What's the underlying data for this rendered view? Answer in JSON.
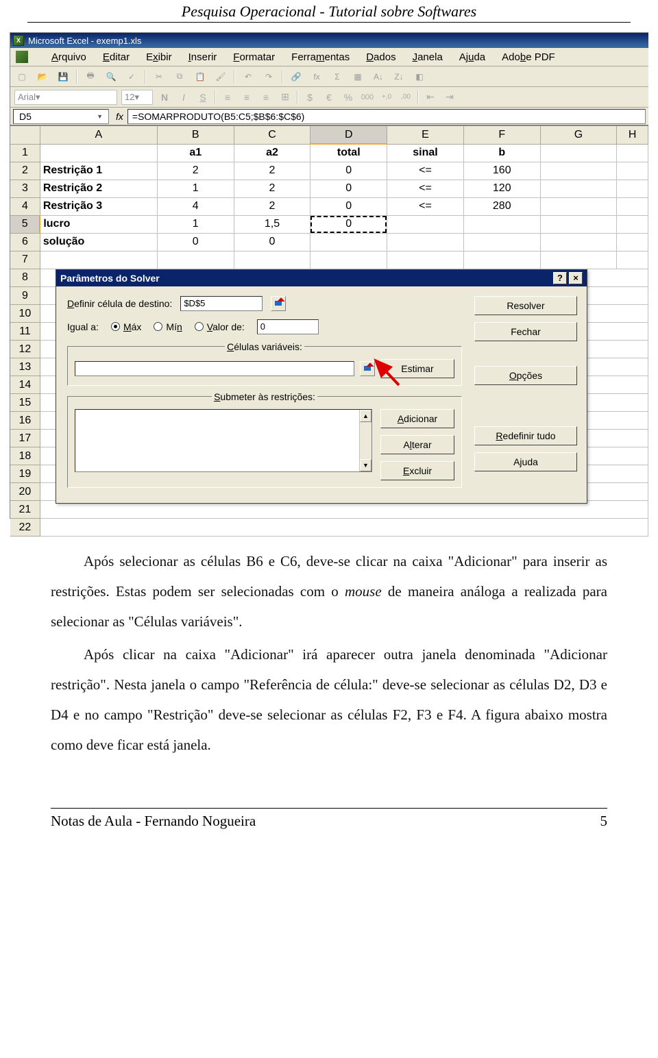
{
  "header_title": "Pesquisa Operacional - Tutorial sobre Softwares",
  "excel": {
    "title": "Microsoft Excel - exemp1.xls",
    "menus": [
      "Arquivo",
      "Editar",
      "Exibir",
      "Inserir",
      "Formatar",
      "Ferramentas",
      "Dados",
      "Janela",
      "Ajuda",
      "Adobe PDF"
    ],
    "font_name": "Arial",
    "font_size": "12",
    "cell_ref": "D5",
    "fx_label": "fx",
    "formula": "=SOMARPRODUTO(B5:C5;$B$6:$C$6)",
    "col_headers": [
      "A",
      "B",
      "C",
      "D",
      "E",
      "F",
      "G",
      "H"
    ],
    "row_numbers": [
      1,
      2,
      3,
      4,
      5,
      6,
      7,
      8,
      9,
      10,
      11,
      12,
      13,
      14,
      15,
      16,
      17,
      18,
      19,
      20,
      21,
      22
    ],
    "selected_col": "D",
    "selected_row": 5,
    "rows": {
      "1": {
        "A": "",
        "B": "a1",
        "C": "a2",
        "D": "total",
        "E": "sinal",
        "F": "b",
        "G": "",
        "H": ""
      },
      "2": {
        "A": "Restrição 1",
        "B": "2",
        "C": "2",
        "D": "0",
        "E": "<=",
        "F": "160",
        "G": "",
        "H": ""
      },
      "3": {
        "A": "Restrição 2",
        "B": "1",
        "C": "2",
        "D": "0",
        "E": "<=",
        "F": "120",
        "G": "",
        "H": ""
      },
      "4": {
        "A": "Restrição 3",
        "B": "4",
        "C": "2",
        "D": "0",
        "E": "<=",
        "F": "280",
        "G": "",
        "H": ""
      },
      "5": {
        "A": "lucro",
        "B": "1",
        "C": "1,5",
        "D": "0",
        "E": "",
        "F": "",
        "G": "",
        "H": ""
      },
      "6": {
        "A": "solução",
        "B": "0",
        "C": "0",
        "D": "",
        "E": "",
        "F": "",
        "G": "",
        "H": ""
      }
    },
    "row1_bold": true,
    "colA_bold": true
  },
  "solver": {
    "title": "Parâmetros do Solver",
    "define_label": "Definir célula de destino:",
    "target_cell": "$D$5",
    "equal_to": "Igual a:",
    "radio_max": "Máx",
    "radio_min": "Mín",
    "radio_val": "Valor de:",
    "value_field": "0",
    "vars_legend": "Células variáveis:",
    "constraints_legend": "Submeter às restrições:",
    "btn_estimate": "Estimar",
    "btn_add": "Adicionar",
    "btn_change": "Alterar",
    "btn_delete": "Excluir",
    "btn_solve": "Resolver",
    "btn_close": "Fechar",
    "btn_options": "Opções",
    "btn_reset": "Redefinir tudo",
    "btn_help": "Ajuda"
  },
  "body": {
    "p1a": "Após selecionar as células B6 e C6, deve-se clicar na caixa \"Adicionar\" para inserir as restrições. Estas podem ser selecionadas com o ",
    "p1_mouse": "mouse",
    "p1b": " de maneira análoga a realizada para selecionar as \"Células variáveis\".",
    "p2": "Após clicar na caixa \"Adicionar\" irá aparecer outra janela denominada \"Adicionar restrição\". Nesta janela o campo \"Referência de célula:\" deve-se selecionar as células D2, D3 e D4 e no campo \"Restrição\" deve-se selecionar as células F2, F3 e F4. A figura abaixo mostra como deve ficar está janela."
  },
  "footer": {
    "left": "Notas de Aula - Fernando Nogueira",
    "right": "5"
  }
}
